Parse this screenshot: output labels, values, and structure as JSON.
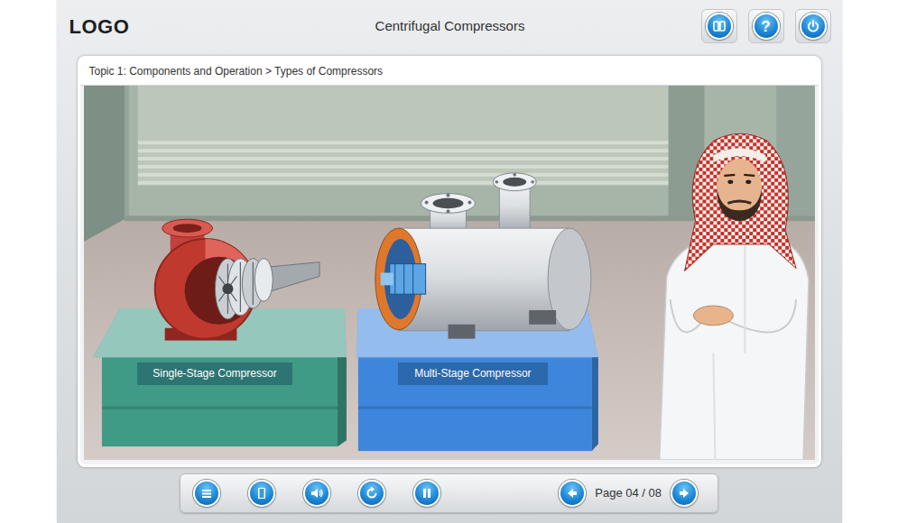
{
  "header": {
    "logo": "LOGO",
    "title": "Centrifugal Compressors",
    "help": "?"
  },
  "breadcrumb": "Topic 1: Components and Operation > Types of Compressors",
  "exhibits": [
    {
      "label": "Single-Stage Compressor",
      "color": "#3f9a86"
    },
    {
      "label": "Multi-Stage Compressor",
      "color": "#3d86dc"
    }
  ],
  "pager": {
    "label": "Page 04 / 08"
  }
}
